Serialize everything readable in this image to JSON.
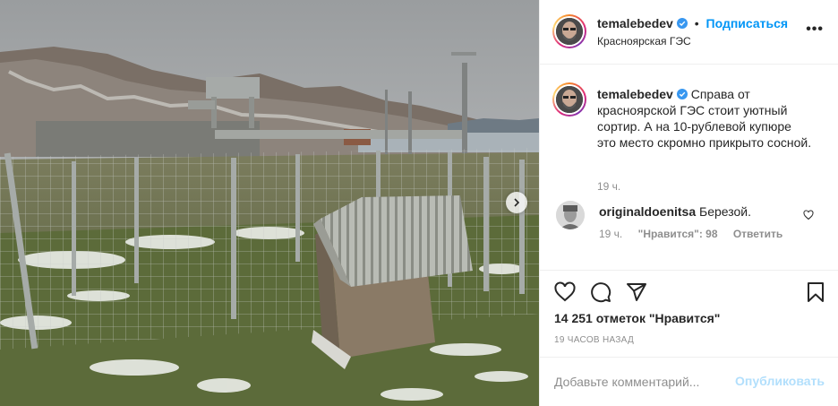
{
  "post": {
    "author": "temalebedev",
    "follow_label": "Подписаться",
    "separator": "•",
    "location": "Красноярская ГЭС",
    "more_label": "•••",
    "verified_color": "#3897f0",
    "caption": "Справа от красноярской ГЭС стоит уютный сортир. А на 10-рублевой купюре это место скромно прикрыто сосной.",
    "caption_time": "19 ч."
  },
  "comments": [
    {
      "author": "originaldoenitsa",
      "text": "Березой.",
      "time": "19 ч.",
      "likes": "\"Нравится\": 98",
      "reply_label": "Ответить"
    }
  ],
  "actions": {
    "like_icon": "heart-icon",
    "comment_icon": "comment-icon",
    "share_icon": "paper-plane-icon",
    "save_icon": "bookmark-icon"
  },
  "likes_text": "14 251 отметок \"Нравится\"",
  "time_ago": "19 ЧАСОВ НАЗАД",
  "composer": {
    "placeholder": "Добавьте комментарий...",
    "publish_label": "Опубликовать"
  },
  "colors": {
    "accent": "#0095f6",
    "publish_disabled": "#b2dffc",
    "secondary_text": "#8e8e8e"
  }
}
